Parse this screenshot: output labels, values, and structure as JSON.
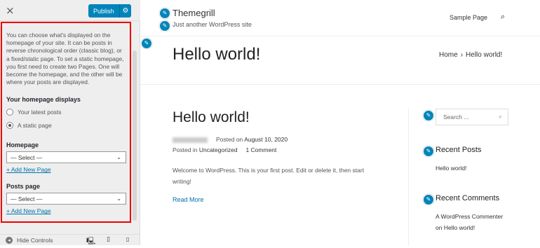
{
  "customizer": {
    "close_icon": "×",
    "publish_label": "Publish",
    "publish_gear": "⚙",
    "description": "You can choose what's displayed on the homepage of your site. It can be posts in reverse chronological order (classic blog), or a fixed/static page. To set a static homepage, you first need to create two Pages. One will become the homepage, and the other will be where your posts are displayed.",
    "homepage_displays_label": "Your homepage displays",
    "option_latest": "Your latest posts",
    "option_static": "A static page",
    "homepage_label": "Homepage",
    "homepage_select": "— Select —",
    "add_new_page": "+ Add New Page",
    "posts_page_label": "Posts page",
    "posts_select": "— Select —",
    "add_new_page_2": "+ Add New Page",
    "hide_controls": "Hide Controls",
    "device_desktop": "🖳",
    "device_tablet": "▯",
    "device_mobile": "▯"
  },
  "preview": {
    "site_title": "Themegrill",
    "tagline": "Just another WordPress site",
    "nav_sample": "Sample Page",
    "search_icon": "🔍",
    "page_title": "Hello world!",
    "breadcrumb_home": "Home",
    "breadcrumb_sep": "›",
    "breadcrumb_current": "Hello world!",
    "post_title": "Hello world!",
    "posted_on_label": "Posted on",
    "post_date": "August 10, 2020",
    "posted_in_label": "Posted in",
    "category": "Uncategorized",
    "comments": "1 Comment",
    "excerpt": "Welcome to WordPress. This is your first post. Edit or delete it, then start writing!",
    "read_more": "Read More",
    "search_placeholder": "Search ...",
    "recent_posts_title": "Recent Posts",
    "recent_post_1": "Hello world!",
    "recent_comments_title": "Recent Comments",
    "comment_author": "A WordPress Commenter",
    "comment_on": "on",
    "comment_post": "Hello world!",
    "pencil_icon": "✎"
  },
  "colors": {
    "accent": "#0085ba",
    "highlight_border": "#ee0000",
    "link": "#0073aa"
  }
}
